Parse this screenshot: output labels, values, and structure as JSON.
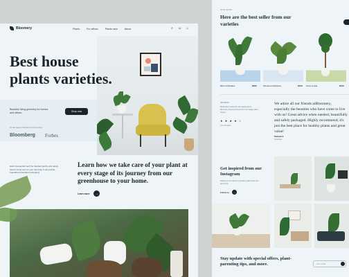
{
  "left": {
    "logo": "Bloomery",
    "nav_links": [
      "Plants",
      "For offices",
      "Plants care",
      "About"
    ],
    "nav_icons": [
      "search-icon",
      "user-icon",
      "bag-icon"
    ],
    "hero_title": "Best house plants varieties.",
    "hero_subtitle": "Beautiful living greenery for homes and offices",
    "shop_button": "Shop now",
    "as_seen": "As we been mentioned in the press",
    "brands": [
      "Bloomberg",
      "Forbes"
    ],
    "care_small": "Each houseplant we'll be handled gently and safely before being sent to your doorstep in all provide beautiful houseplant packaging.",
    "care_title": "Learn how we take care of your plant at every stage of its journey from our greenhouse to your home.",
    "learn_more": "Learn more"
  },
  "right": {
    "bestseller_tag": "OUR SHOP",
    "bestseller_title": "Here are the best seller from our varieties",
    "products": [
      {
        "name": "Bird of Paradise",
        "price": "$290",
        "bg": "#b9d3ea"
      },
      {
        "name": "Monstera Deliciosa",
        "price": "$150",
        "bg": "#d9e6f2"
      },
      {
        "name": "Ficus Lyrata",
        "price": "$120",
        "bg": "#e7ecee"
      }
    ],
    "reviews_tag": "REVIEWS",
    "reviews_desc": "Read what customers are saying about Bloomery. Real comments from our happy plant buyers.",
    "stars": "★ ★ ★ ★ ☆",
    "rating_note": "4.9 of 5 stars",
    "quote": "We adore all our friends atBloomery, especially the beauties who have come to live with us! Great advice when needed, beautifully and safely packaged. Highly recommend, it's just the best place for healthy plants and great value!",
    "author": "Pamela S",
    "author_role": "Customer",
    "insta_title": "Get inspired from our Instagram",
    "insta_desc": "Follow us for interior inspiration, plant care tips and more.",
    "insta_follow": "Follow us",
    "news_title": "Stay update with special offers, plant-parenting tips, and more.",
    "news_placeholder": "Your email"
  }
}
